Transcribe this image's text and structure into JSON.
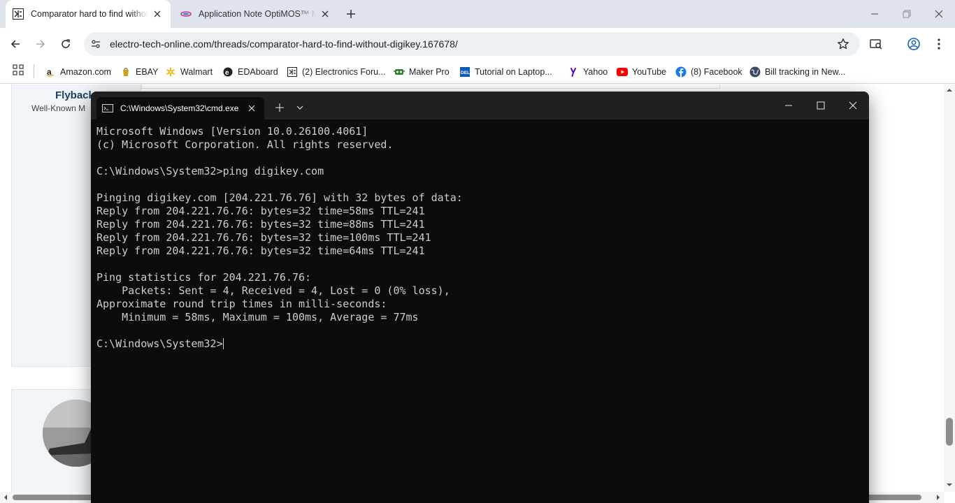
{
  "browser": {
    "tabs": [
      {
        "title": "Comparator hard to find without digikey",
        "active": true
      },
      {
        "title": "Application Note OptiMOS™ Mosfets",
        "active": false
      }
    ],
    "url": "electro-tech-online.com/threads/comparator-hard-to-find-without-digikey.167678/",
    "bookmarks": [
      {
        "label": "Amazon.com",
        "icon": "amazon-icon"
      },
      {
        "label": "EBAY",
        "icon": "ebay-icon"
      },
      {
        "label": "Walmart",
        "icon": "walmart-icon"
      },
      {
        "label": "EDAboard",
        "icon": "edaboard-icon"
      },
      {
        "label": "(2) Electronics Foru...",
        "icon": "eto-icon"
      },
      {
        "label": "Maker Pro",
        "icon": "makerpro-icon"
      },
      {
        "label": "Tutorial on Laptop...",
        "icon": "dell-icon"
      },
      {
        "label": "Yahoo",
        "icon": "yahoo-icon"
      },
      {
        "label": "YouTube",
        "icon": "youtube-icon"
      },
      {
        "label": "(8) Facebook",
        "icon": "facebook-icon"
      },
      {
        "label": "Bill tracking in New...",
        "icon": "globe-icon"
      }
    ]
  },
  "page": {
    "user1": {
      "name": "Flyback",
      "role": "Well-Known M"
    }
  },
  "terminal": {
    "tab_title": "C:\\Windows\\System32\\cmd.exe",
    "lines": [
      "Microsoft Windows [Version 10.0.26100.4061]",
      "(c) Microsoft Corporation. All rights reserved.",
      "",
      "C:\\Windows\\System32>ping digikey.com",
      "",
      "Pinging digikey.com [204.221.76.76] with 32 bytes of data:",
      "Reply from 204.221.76.76: bytes=32 time=58ms TTL=241",
      "Reply from 204.221.76.76: bytes=32 time=88ms TTL=241",
      "Reply from 204.221.76.76: bytes=32 time=100ms TTL=241",
      "Reply from 204.221.76.76: bytes=32 time=64ms TTL=241",
      "",
      "Ping statistics for 204.221.76.76:",
      "    Packets: Sent = 4, Received = 4, Lost = 0 (0% loss),",
      "Approximate round trip times in milli-seconds:",
      "    Minimum = 58ms, Maximum = 100ms, Average = 77ms",
      ""
    ],
    "prompt": "C:\\Windows\\System32>"
  },
  "colors": {
    "terminal_bg": "#0c0c0c",
    "terminal_fg": "#cccccc",
    "chrome_frame": "#dfe3eb",
    "link_navy": "#1d3f63"
  }
}
